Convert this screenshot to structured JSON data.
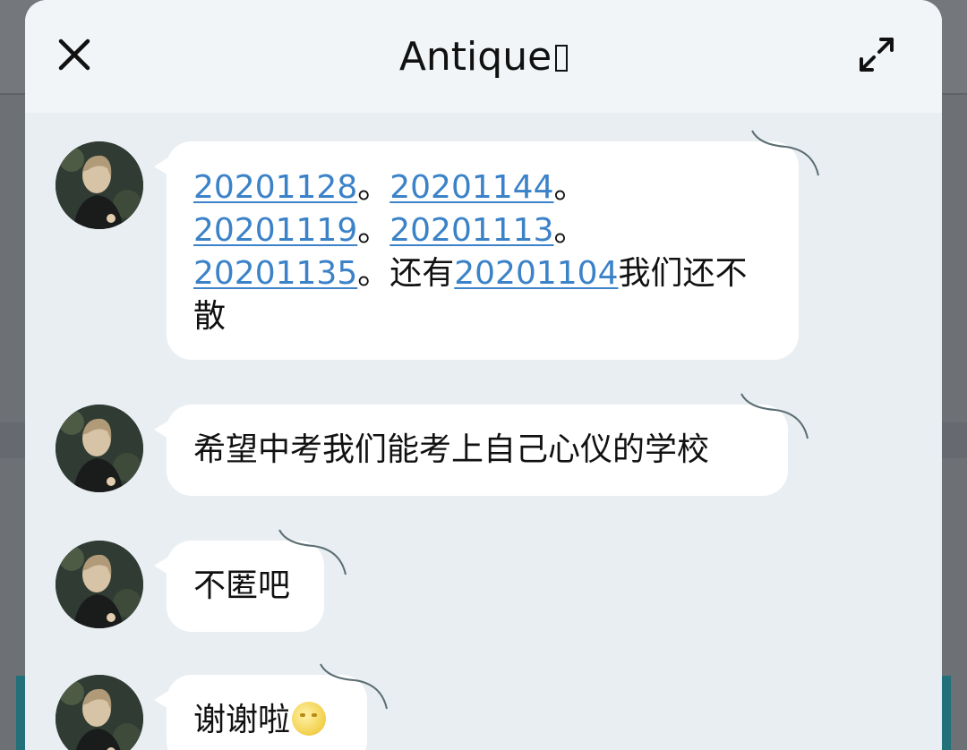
{
  "header": {
    "title": "Antique",
    "close_icon": "close-icon",
    "expand_icon": "expand-icon"
  },
  "messages": [
    {
      "id": "m1",
      "segments": [
        {
          "text": "20201128",
          "link": true
        },
        {
          "text": "。",
          "link": false
        },
        {
          "text": "20201144",
          "link": true
        },
        {
          "text": "。",
          "link": false
        },
        {
          "text": "20201119",
          "link": true
        },
        {
          "text": "。",
          "link": false
        },
        {
          "text": "20201113",
          "link": true
        },
        {
          "text": "。",
          "link": false
        },
        {
          "text": "20201135",
          "link": true
        },
        {
          "text": "。还有",
          "link": false
        },
        {
          "text": "20201104",
          "link": true
        },
        {
          "text": "我们还不散",
          "link": false
        }
      ]
    },
    {
      "id": "m2",
      "text": "希望中考我们能考上自己心仪的学校"
    },
    {
      "id": "m3",
      "text": "不匿吧"
    },
    {
      "id": "m4",
      "text": "谢谢啦",
      "emoji": "moon-face-emoji"
    }
  ],
  "colors": {
    "link": "#3b82c8",
    "bubble": "#ffffff",
    "chat_bg": "#e9eef2",
    "header_bg": "#f1f5f8"
  }
}
